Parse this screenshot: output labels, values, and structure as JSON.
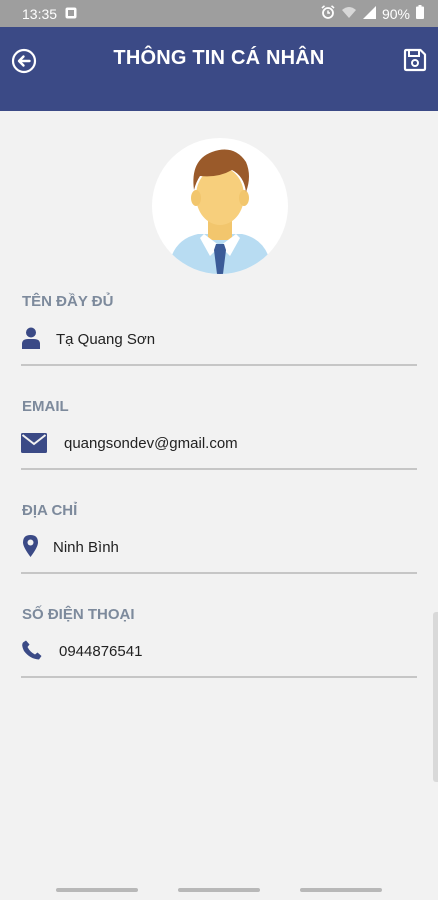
{
  "status_bar": {
    "time": "13:35",
    "battery_text": "90%"
  },
  "header": {
    "title": "THÔNG TIN CÁ NHÂN",
    "back_icon": "back-arrow-circle-icon",
    "save_icon": "save-floppy-icon",
    "color": "#3b4a86"
  },
  "profile": {
    "avatar_icon": "male-avatar-illustration",
    "fields": [
      {
        "label": "TÊN ĐẦY ĐỦ",
        "value": "Tạ Quang Sơn",
        "icon": "user-icon"
      },
      {
        "label": "EMAIL",
        "value": "quangsondev@gmail.com",
        "icon": "envelope-icon"
      },
      {
        "label": "ĐỊA CHỈ",
        "value": "Ninh Bình",
        "icon": "map-marker-icon"
      },
      {
        "label": "SỐ ĐIỆN THOẠI",
        "value": "0944876541",
        "icon": "phone-icon"
      }
    ]
  },
  "colors": {
    "accent": "#3b4a86",
    "label": "#7d8a9c",
    "divider": "#c6c6c6",
    "background": "#f2f2f2"
  }
}
